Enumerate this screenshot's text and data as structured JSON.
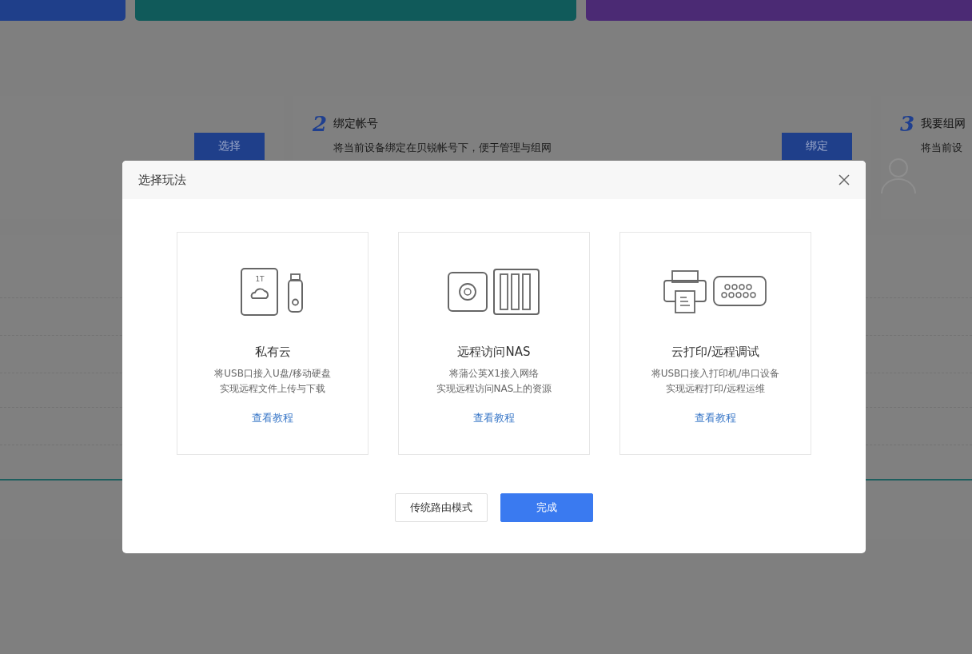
{
  "steps": [
    {
      "kind": "action",
      "button": "选择"
    },
    {
      "kind": "full",
      "number": "2",
      "title": "绑定帐号",
      "description": "将当前设备绑定在贝锐帐号下，便于管理与组网",
      "button": "绑定"
    },
    {
      "kind": "avatar",
      "number": "3",
      "title": "我要组网",
      "description": "将当前设"
    }
  ],
  "dialog": {
    "title": "选择玩法",
    "options": [
      {
        "kind": "cloud",
        "title": "私有云",
        "lines": [
          "将USB口接入U盘/移动硬盘",
          "实现远程文件上传与下载"
        ],
        "link": "查看教程",
        "badge": "1T"
      },
      {
        "kind": "nas",
        "title": "远程访问NAS",
        "lines": [
          "将蒲公英X1接入网络",
          "实现远程访问NAS上的资源"
        ],
        "link": "查看教程"
      },
      {
        "kind": "print",
        "title": "云打印/远程调试",
        "lines": [
          "将USB口接入打印机/串口设备",
          "实现远程打印/远程运维"
        ],
        "link": "查看教程"
      }
    ],
    "buttons": [
      {
        "label": "传统路由模式",
        "primary": false
      },
      {
        "label": "完成",
        "primary": true
      }
    ]
  }
}
